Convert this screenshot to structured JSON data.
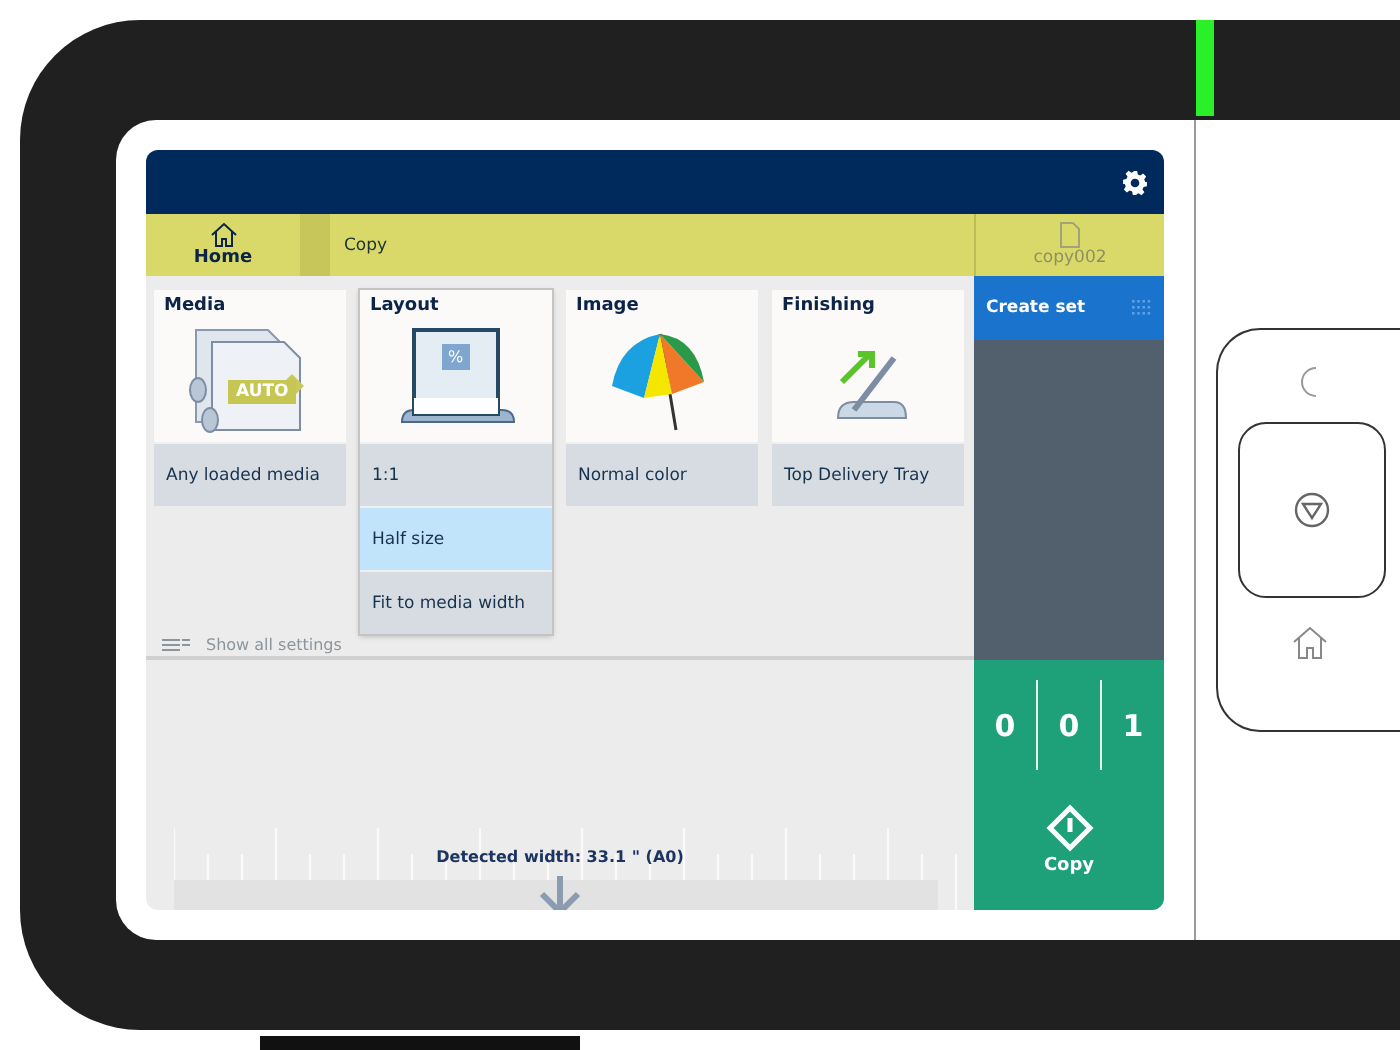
{
  "breadcrumb": {
    "home": "Home",
    "current": "Copy"
  },
  "job": {
    "name": "copy002"
  },
  "tiles": [
    {
      "title": "Media",
      "badge": "AUTO",
      "expanded": false,
      "options": [
        {
          "label": "Any loaded media",
          "selected": false
        }
      ]
    },
    {
      "title": "Layout",
      "badge": "%",
      "expanded": true,
      "options": [
        {
          "label": "1:1",
          "selected": false
        },
        {
          "label": "Half size",
          "selected": true
        },
        {
          "label": "Fit to media width",
          "selected": false
        }
      ]
    },
    {
      "title": "Image",
      "expanded": false,
      "options": [
        {
          "label": "Normal color",
          "selected": false
        }
      ]
    },
    {
      "title": "Finishing",
      "expanded": false,
      "options": [
        {
          "label": "Top Delivery Tray",
          "selected": false
        }
      ]
    }
  ],
  "show_all": "Show all settings",
  "create_set": "Create set",
  "counter": [
    "0",
    "0",
    "1"
  ],
  "copy_button": "Copy",
  "detected_width": "Detected width: 33.1 \" (A0)"
}
